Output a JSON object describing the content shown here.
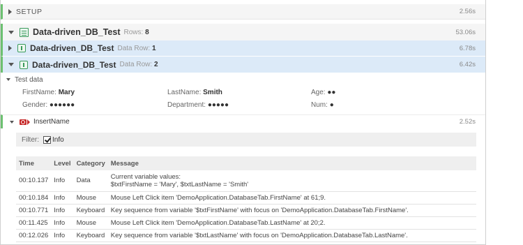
{
  "setup": {
    "label": "SETUP",
    "time": "2.56s"
  },
  "data_driven": {
    "title": "Data-driven_DB_Test",
    "meta_label": "Rows:",
    "meta_value": "8",
    "time": "53.06s"
  },
  "rows": [
    {
      "title": "Data-driven_DB_Test",
      "meta_label": "Data Row:",
      "meta_value": "1",
      "time": "6.78s",
      "expanded": false
    },
    {
      "title": "Data-driven_DB_Test",
      "meta_label": "Data Row:",
      "meta_value": "2",
      "time": "6.42s",
      "expanded": true
    }
  ],
  "test_data": {
    "header": "Test data",
    "firstname_label": "FirstName:",
    "firstname_value": "Mary",
    "lastname_label": "LastName:",
    "lastname_value": "Smith",
    "age_label": "Age:",
    "age_value": "●●",
    "gender_label": "Gender:",
    "gender_value": "●●●●●●",
    "department_label": "Department:",
    "department_value": "●●●●●",
    "num_label": "Num:",
    "num_value": "●"
  },
  "insert": {
    "label": "InsertName",
    "time": "2.52s"
  },
  "filter": {
    "label": "Filter:",
    "option": "Info",
    "checked": true
  },
  "log": {
    "headers": {
      "time": "Time",
      "level": "Level",
      "category": "Category",
      "message": "Message"
    },
    "rows": [
      {
        "time": "00:10.137",
        "level": "Info",
        "category": "Data",
        "message_line1": "Current variable values:",
        "message_line2": "$txtFirstName = 'Mary', $txtLastName = 'Smith'"
      },
      {
        "time": "00:10.184",
        "level": "Info",
        "category": "Mouse",
        "message_line1": "Mouse Left Click item 'DemoApplication.DatabaseTab.FirstName' at 61;9.",
        "message_line2": ""
      },
      {
        "time": "00:10.771",
        "level": "Info",
        "category": "Keyboard",
        "message_line1": "Key sequence from variable '$txtFirstName' with focus on 'DemoApplication.DatabaseTab.FirstName'.",
        "message_line2": ""
      },
      {
        "time": "00:11.425",
        "level": "Info",
        "category": "Mouse",
        "message_line1": "Mouse Left Click item 'DemoApplication.DatabaseTab.LastName' at 20;2.",
        "message_line2": ""
      },
      {
        "time": "00:12.026",
        "level": "Info",
        "category": "Keyboard",
        "message_line1": "Key sequence from variable '$txtLastName' with focus on 'DemoApplication.DatabaseTab.LastName'.",
        "message_line2": ""
      }
    ]
  }
}
